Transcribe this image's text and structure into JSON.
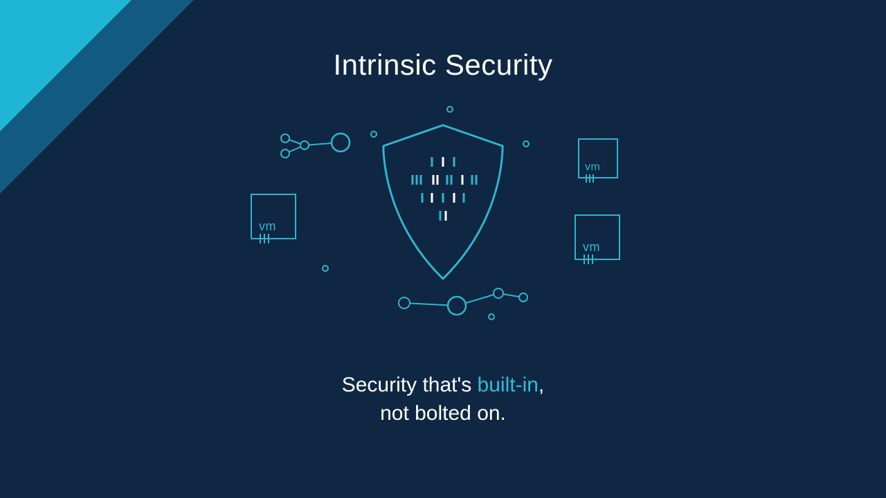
{
  "title": "Intrinsic Security",
  "tagline": {
    "prefix": "Security that's ",
    "highlight": "built-in",
    "suffix_line1": ",",
    "line2": "not bolted on."
  },
  "vm_label": "vm",
  "colors": {
    "background": "#0f2742",
    "accent": "#2fb4cf",
    "tri_dark": "#135a82",
    "tri_light": "#1fb6d6",
    "white": "#ffffff"
  }
}
